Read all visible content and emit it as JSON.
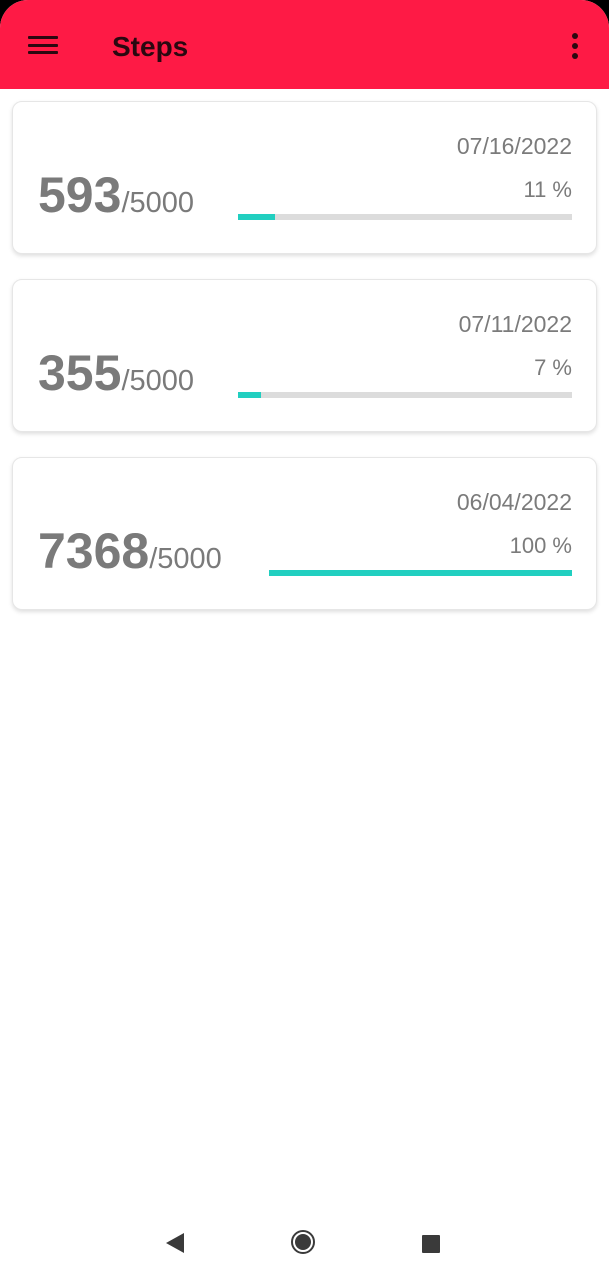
{
  "app_bar": {
    "title": "Steps",
    "color": "#fe1a45",
    "menu_icon": "hamburger-menu-icon",
    "overflow_icon": "more-vert-icon"
  },
  "entries": [
    {
      "date": "07/16/2022",
      "steps": "593",
      "goal": "/5000",
      "percent_label": "11 %",
      "progress": 0.11
    },
    {
      "date": "07/11/2022",
      "steps": "355",
      "goal": "/5000",
      "percent_label": "7 %",
      "progress": 0.07
    },
    {
      "date": "06/04/2022",
      "steps": "7368",
      "goal": "/5000",
      "percent_label": "100 %",
      "progress": 1.0
    }
  ],
  "progress_color": "#21cfc0",
  "nav_bar": {
    "back_icon": "back-triangle-icon",
    "home_icon": "home-circle-icon",
    "recents_icon": "recents-square-icon"
  }
}
